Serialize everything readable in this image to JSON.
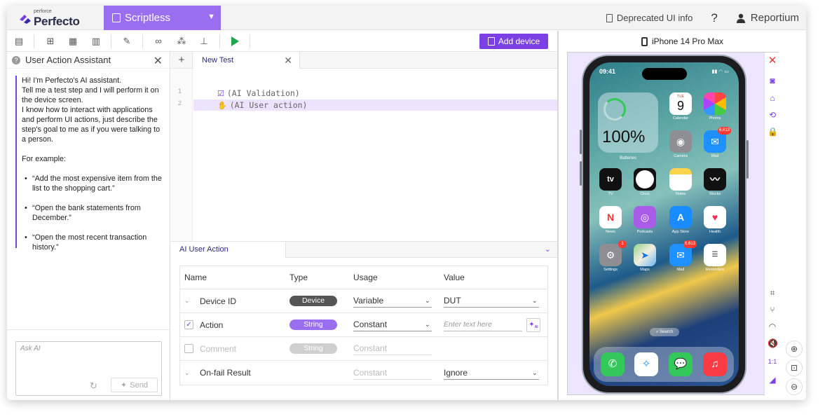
{
  "brand": {
    "small": "perforce",
    "name": "Perfecto"
  },
  "module": {
    "label": "Scriptless"
  },
  "topbar": {
    "deprecated": "Deprecated UI info",
    "help": "?",
    "user": "Reportium"
  },
  "toolbar": {
    "add_device": "Add device"
  },
  "assistant": {
    "title": "User Action Assistant",
    "intro": "Hi! I'm Perfecto's AI assistant.\nTell me a test step and I will perform it on the device screen.\nI know how to interact with applications and perform UI actions, just describe the step's goal to me as if you were talking to a person.",
    "example_label": "For example:",
    "examples": [
      "“Add the most expensive item from the list to the shopping cart.”",
      "“Open the bank statements from December.”",
      "“Open the most recent transaction history.”"
    ],
    "ask_placeholder": "Ask AI",
    "send": "Send"
  },
  "editor": {
    "tab": "New Test",
    "lines": [
      {
        "n": "1",
        "text": "(AI Validation)"
      },
      {
        "n": "2",
        "text": "(AI User action)"
      }
    ]
  },
  "ai_action": {
    "tab": "AI User Action",
    "headers": [
      "Name",
      "Type",
      "Usage",
      "Value"
    ],
    "rows": [
      {
        "name": "Device ID",
        "type": "Device",
        "usage": "Variable",
        "value": "DUT"
      },
      {
        "name": "Action",
        "type": "String",
        "usage": "Constant",
        "value_placeholder": "Enter text here",
        "ai_btn": "AI"
      },
      {
        "name": "Comment",
        "type": "String",
        "usage": "Constant",
        "value": ""
      },
      {
        "name": "On-fail Result",
        "type": "",
        "usage": "Constant",
        "value": "Ignore"
      }
    ]
  },
  "device": {
    "title": "iPhone 14 Pro Max",
    "time": "09:41",
    "battery_pct": "100%",
    "battery_label": "Batteries",
    "calendar_day": "TUE",
    "calendar_num": "9",
    "badge": "6,613",
    "badge_settings": "1",
    "search": "Search",
    "apps": [
      "Calendar",
      "Photos",
      "Camera",
      "Mail",
      "TV",
      "Clock",
      "Notes",
      "Stocks",
      "News",
      "Podcasts",
      "App Store",
      "Health",
      "Settings",
      "Maps",
      "Mail",
      "Reminders"
    ],
    "tv_label": "tv",
    "ratio": "1:1"
  },
  "colors": {
    "accent": "#7b3fe4",
    "module": "#9b6ef0",
    "play": "#1fa64a"
  }
}
